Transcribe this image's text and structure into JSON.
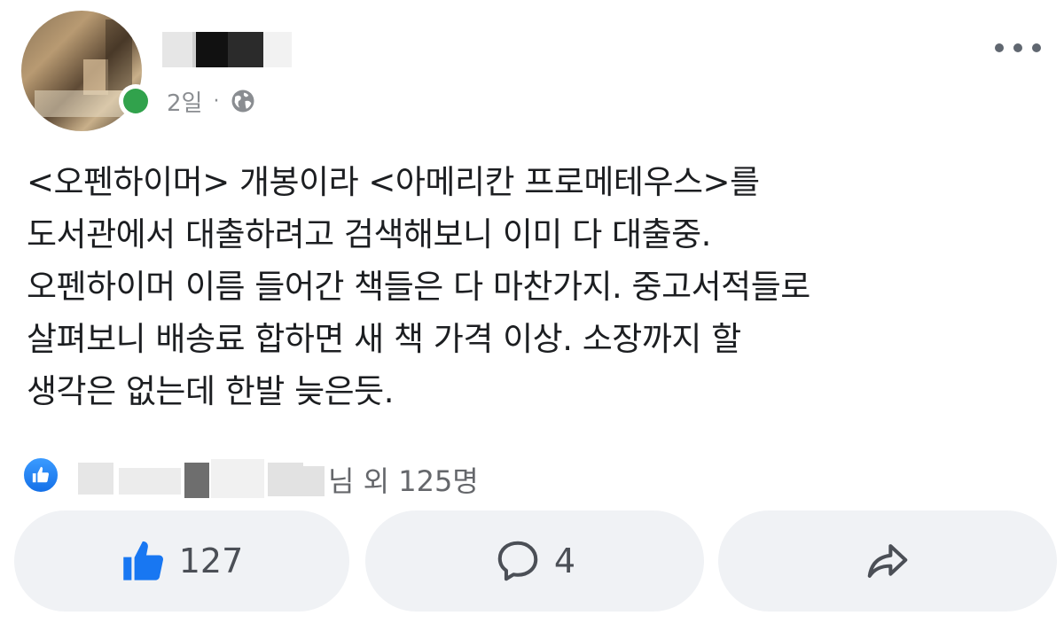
{
  "post": {
    "time": "2일",
    "separator": "·",
    "privacy_icon": "globe-icon",
    "more_icon": "more-horizontal-icon",
    "text_lines": [
      "<오펜하이머> 개봉이라 <아메리칸 프로메테우스>를",
      "도서관에서 대출하려고 검색해보니 이미 다 대출중.",
      "오펜하이머 이름 들어간 책들은 다 마찬가지. 중고서적들로",
      "살펴보니 배송료 합하면 새 책 가격 이상. 소장까지 할",
      "생각은 없는데 한발 늦은듯."
    ]
  },
  "reactions": {
    "icon": "like-reaction-icon",
    "summary_suffix": "님 외 125명"
  },
  "actions": {
    "like_count": "127",
    "comment_count": "4",
    "like_icon": "thumbs-up-icon",
    "comment_icon": "comment-bubble-icon",
    "share_icon": "share-arrow-icon"
  },
  "colors": {
    "online": "#31a24c",
    "like_blue": "#1877f2",
    "button_bg": "#f0f2f5",
    "meta_gray": "#8a8d91"
  }
}
